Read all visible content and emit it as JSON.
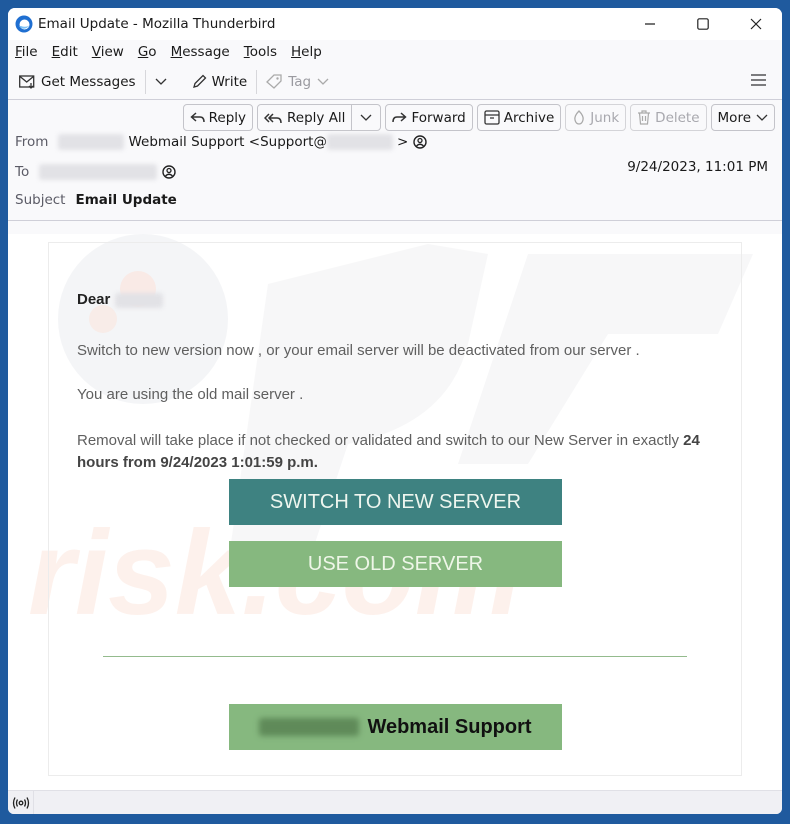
{
  "window": {
    "title": "Email Update - Mozilla Thunderbird"
  },
  "menubar": {
    "items": [
      {
        "key": "F",
        "rest": "ile"
      },
      {
        "key": "E",
        "rest": "dit"
      },
      {
        "key": "V",
        "rest": "iew"
      },
      {
        "key": "G",
        "rest": "o"
      },
      {
        "key": "M",
        "rest": "essage"
      },
      {
        "key": "T",
        "rest": "ools"
      },
      {
        "key": "H",
        "rest": "elp"
      }
    ]
  },
  "toolbar": {
    "get_messages": "Get Messages",
    "write": "Write",
    "tag": "Tag"
  },
  "actions": {
    "reply": "Reply",
    "reply_all": "Reply All",
    "forward": "Forward",
    "archive": "Archive",
    "junk": "Junk",
    "delete": "Delete",
    "more": "More"
  },
  "header": {
    "from_label": "From",
    "from_name": "Webmail Support <Support@",
    "from_close": ">",
    "to_label": "To",
    "subject_label": "Subject",
    "subject": "Email Update",
    "date": "9/24/2023, 11:01 PM"
  },
  "email": {
    "dear": "Dear",
    "p1": "Switch to new version now  , or your email server will be deactivated from our server .",
    "p2": "You  are using the old  mail server .",
    "p3_normal": "Removal will take place if not checked or validated and switch to our New Server in exactly ",
    "p3_bold": "24 hours from 9/24/2023 1:01:59 p.m.",
    "cta_new": "SWITCH TO NEW SERVER",
    "cta_old": "USE OLD SERVER",
    "signature": "Webmail Support"
  },
  "colors": {
    "titlebar_bg": "#ffffff",
    "desktop_bg": "#1f5a9e",
    "cta_new_bg": "#3e8281",
    "cta_old_bg": "#86b87f"
  }
}
